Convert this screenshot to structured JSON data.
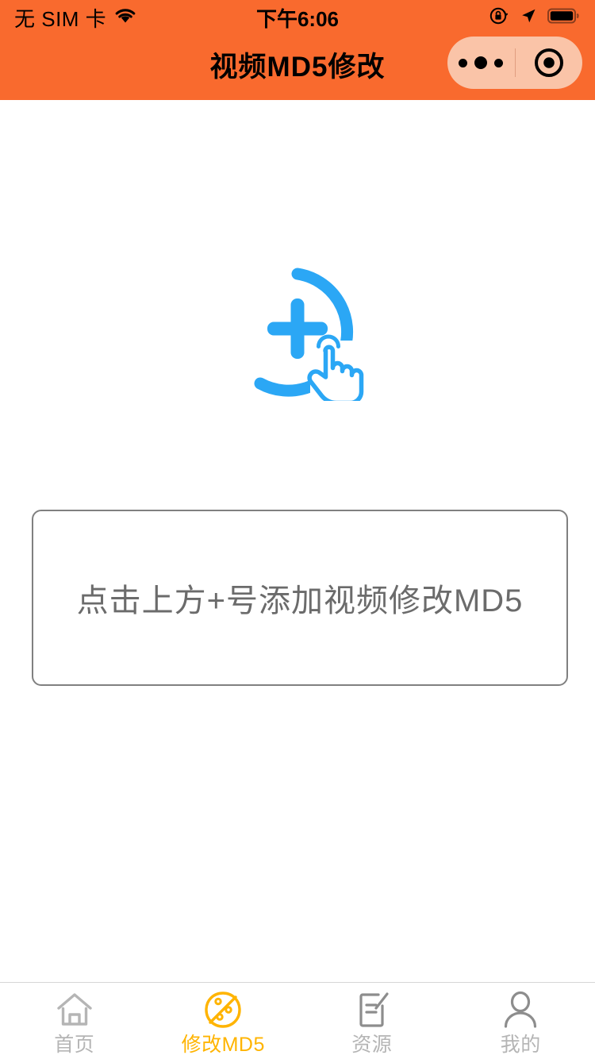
{
  "status_bar": {
    "carrier": "无 SIM 卡",
    "time": "下午6:06",
    "wifi_icon": "wifi-icon",
    "rotation_lock_icon": "rotation-lock-icon",
    "location_icon": "location-arrow-icon",
    "battery_icon": "battery-icon"
  },
  "header": {
    "title": "视频MD5修改",
    "background_color": "#f96a2e",
    "title_color": "#000000",
    "capsule": {
      "background_color": "#fac4a8",
      "menu_icon": "ellipsis-icon",
      "close_icon": "target-circle-icon"
    }
  },
  "main": {
    "add_button": {
      "icon": "plus-circle-tap-icon",
      "color": "#2ba7f5"
    },
    "empty_hint": {
      "text": "点击上方+号添加视频修改MD5",
      "text_color": "#6b6b6b",
      "border_color": "#808080"
    }
  },
  "tab_bar": {
    "active_color": "#ffb400",
    "inactive_color": "#b5b5b5",
    "items": [
      {
        "label": "首页",
        "icon": "home-icon",
        "active": false
      },
      {
        "label": "修改MD5",
        "icon": "palette-icon",
        "active": true
      },
      {
        "label": "资源",
        "icon": "document-edit-icon",
        "active": false
      },
      {
        "label": "我的",
        "icon": "person-icon",
        "active": false
      }
    ]
  }
}
